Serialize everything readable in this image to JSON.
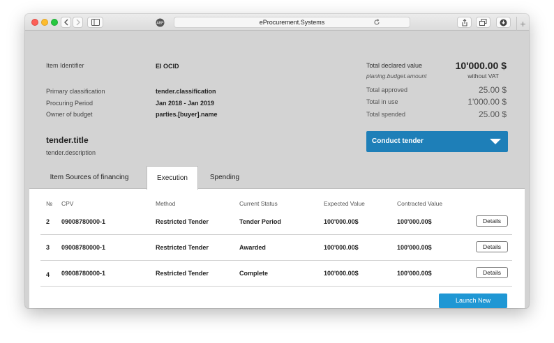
{
  "browser": {
    "url": "eProcurement.Systems"
  },
  "header": {
    "item_identifier_label": "Item Identifier",
    "item_identifier_value": "EI OCID",
    "primary_classification_label": "Primary classification",
    "primary_classification_value": "tender.classification",
    "procuring_period_label": "Procuring Period",
    "procuring_period_value": "Jan 2018 - Jan 2019",
    "owner_label": "Owner of budget",
    "owner_value": "parties.[buyer].name",
    "tender_title": "tender.title",
    "tender_description": "tender.description"
  },
  "budget": {
    "declared_label": "Total declared value",
    "declared_source": "planing.budget.amount",
    "declared_amount": "10'000.00 $",
    "vat_note": "without VAT",
    "approved_label": "Total approved",
    "approved_value": "25.00 $",
    "in_use_label": "Total in use",
    "in_use_value": "1'000.00 $",
    "spended_label": "Total spended",
    "spended_value": "25.00 $"
  },
  "conduct_button": "Conduct tender",
  "tabs": [
    {
      "label": "Item Sources of financing",
      "active": false
    },
    {
      "label": "Execution",
      "active": true
    },
    {
      "label": "Spending",
      "active": false
    }
  ],
  "table": {
    "headers": [
      "№",
      "CPV",
      "Method",
      "Current Status",
      "Expected Value",
      "Contracted Value"
    ],
    "details_label": "Details",
    "rows": [
      {
        "no": "2",
        "cpv": "09008780000-1",
        "method": "Restricted Tender",
        "status": "Tender Period",
        "expected": "100'000.00$",
        "contracted": "100'000.00$"
      },
      {
        "no": "3",
        "cpv": "09008780000-1",
        "method": "Restricted Tender",
        "status": "Awarded",
        "expected": "100'000.00$",
        "contracted": "100'000.00$"
      },
      {
        "no": "4",
        "cpv": "09008780000-1",
        "method": "Restricted Tender",
        "status": "Complete",
        "expected": "100'000.00$",
        "contracted": "100'000.00$"
      }
    ]
  },
  "launch_button": "Launch New",
  "colors": {
    "accent": "#1e7fb8",
    "launch": "#1f97d4",
    "header_bg": "#d3d3d3"
  }
}
